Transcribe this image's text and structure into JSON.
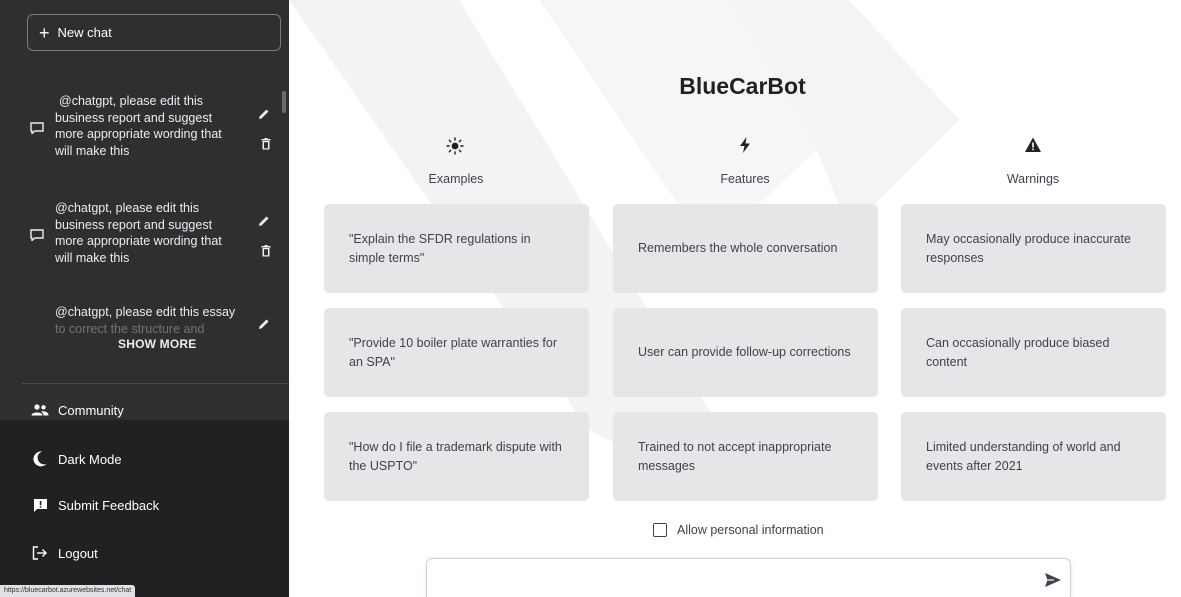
{
  "sidebar": {
    "new_chat_label": "New chat",
    "chats": [
      {
        "lines": [
          "@chatgpt, please edit this",
          "business report and suggest",
          "more appropriate wording that",
          "will make this"
        ]
      },
      {
        "lines": [
          "@chatgpt, please edit this",
          "business report and suggest",
          "more appropriate wording that",
          "will make this"
        ]
      },
      {
        "lines": [
          "@chatgpt, please edit this essay",
          "to correct the structure and"
        ]
      }
    ],
    "show_more_label": "SHOW MORE",
    "menu": {
      "community": "Community",
      "dark_mode": "Dark Mode",
      "submit_feedback": "Submit Feedback",
      "logout": "Logout"
    },
    "status_url": "https://bluecarbot.azurewebsites.net/chat"
  },
  "main": {
    "title": "BlueCarBot",
    "columns": [
      {
        "heading": "Examples",
        "icon": "sun-icon",
        "cards": [
          "\"Explain the SFDR regulations in simple terms\"",
          "\"Provide 10 boiler plate warranties for an SPA\"",
          "\"How do I file a trademark dispute with the USPTO\""
        ]
      },
      {
        "heading": "Features",
        "icon": "lightning-icon",
        "cards": [
          "Remembers the whole conversation",
          "User can provide follow-up corrections",
          "Trained to not accept inappropriate messages"
        ]
      },
      {
        "heading": "Warnings",
        "icon": "warning-icon",
        "cards": [
          "May occasionally produce inaccurate responses",
          "Can occasionally produce biased content",
          "Limited understanding of world and events after 2021"
        ]
      }
    ],
    "allow_personal_label": "Allow personal information",
    "allow_personal_checked": false,
    "message_input": {
      "value": "",
      "placeholder": ""
    }
  },
  "colors": {
    "sidebar_upper": "#2f2f31",
    "sidebar_lower": "#202123",
    "card_bg": "#e6e6e8",
    "text": "#40414f"
  }
}
